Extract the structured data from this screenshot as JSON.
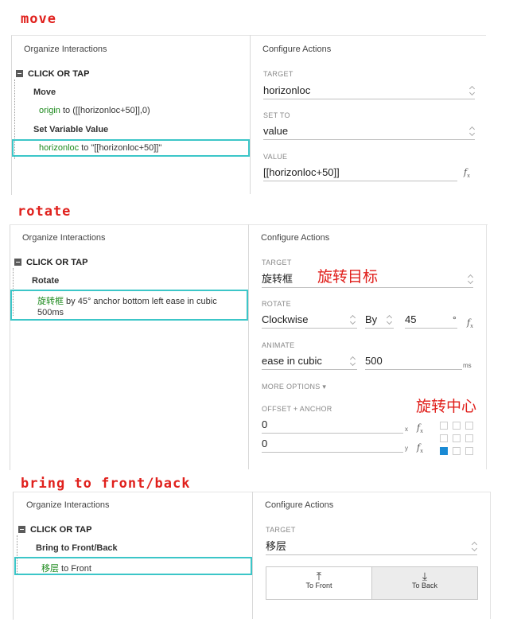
{
  "sections": {
    "move": "move",
    "rotate": "rotate",
    "bring": "bring to front/back"
  },
  "common": {
    "organize": "Organize Interactions",
    "configure": "Configure Actions",
    "click_or_tap": "CLICK OR TAP",
    "target_label": "TARGET"
  },
  "move_panel": {
    "action1": "Move",
    "line1_green": "origin",
    "line1_rest": " to ([[horizonloc+50]],0)",
    "action2": "Set Variable Value",
    "line2_green": "horizonloc",
    "line2_rest": " to \"[[horizonloc+50]]\"",
    "target_value": "horizonloc",
    "setto_label": "SET TO",
    "setto_value": "value",
    "value_label": "VALUE",
    "value_value": "[[horizonloc+50]]"
  },
  "rotate_panel": {
    "action": "Rotate",
    "line_green": "旋转框",
    "line_rest": " by 45° anchor bottom left ease in cubic",
    "line_rest2": "500ms",
    "target_value": "旋转框",
    "annotation_target": "旋转目标",
    "rotate_label": "ROTATE",
    "rotate_dir": "Clockwise",
    "rotate_by": "By",
    "rotate_deg": "45",
    "deg_unit": "°",
    "animate_label": "ANIMATE",
    "animate_value": "ease in cubic",
    "animate_ms": "500",
    "ms_unit": "ms",
    "more_options": "MORE OPTIONS ▾",
    "offset_label": "OFFSET + ANCHOR",
    "offset_x": "0",
    "offset_y": "0",
    "x_unit": "x",
    "y_unit": "y",
    "annotation_anchor": "旋转中心"
  },
  "bring_panel": {
    "action": "Bring to Front/Back",
    "line_green": "移层",
    "line_rest": " to Front",
    "target_value": "移层",
    "to_front": "To Front",
    "to_back": "To Back"
  },
  "colors": {
    "annotation": "#e0201c",
    "highlight": "#3cc6c8",
    "green_link": "#1e8a1e",
    "anchor_selected": "#1a8ad4"
  },
  "icons": [
    "minus-square-icon",
    "updown-arrows-icon",
    "fx-icon",
    "arrow-up-bar-icon",
    "arrow-down-bar-icon"
  ]
}
